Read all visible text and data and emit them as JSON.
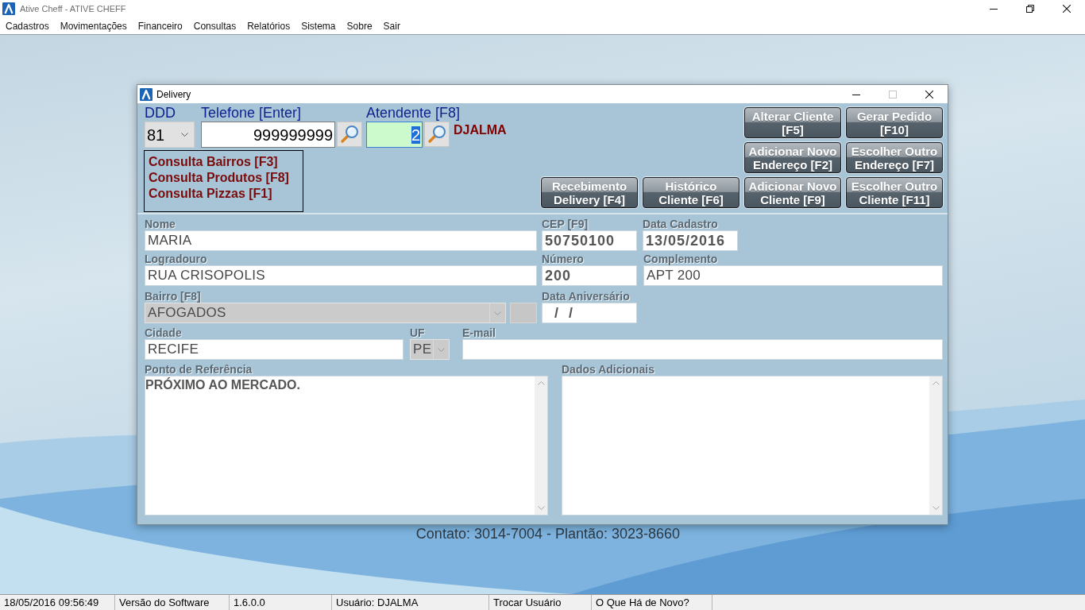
{
  "window": {
    "title": "Ative Cheff - ATIVE CHEFF",
    "controls": [
      {
        "kind": "minimize",
        "disabled": false
      },
      {
        "kind": "restore",
        "disabled": false
      },
      {
        "kind": "close",
        "disabled": false
      }
    ]
  },
  "menu": [
    "Cadastros",
    "Movimentações",
    "Financeiro",
    "Consultas",
    "Relatórios",
    "Sistema",
    "Sobre",
    "Sair"
  ],
  "desktop": {
    "contact": "Contato: 3014-7004 - Plantão: 3023-8660"
  },
  "dialog": {
    "title": "Delivery",
    "controls": [
      {
        "kind": "minimize",
        "disabled": false
      },
      {
        "kind": "maximize",
        "disabled": true
      },
      {
        "kind": "close",
        "disabled": false
      }
    ],
    "lookup": [
      {
        "kind": "select",
        "label": "DDD",
        "value": "81",
        "focused": false
      },
      {
        "kind": "search",
        "label": "Telefone [Enter]",
        "value": "999999999",
        "focused": false
      },
      {
        "kind": "search",
        "label": "Atendente [F8]",
        "value": "2",
        "focused": true,
        "result": "DJALMA"
      }
    ],
    "shortcuts": [
      "Consulta Bairros [F3]",
      "Consulta Produtos [F8]",
      "Consulta Pizzas [F1]"
    ],
    "button_rows": [
      [
        {
          "lines": [
            "Alterar Cliente",
            "[F5]"
          ]
        },
        {
          "lines": [
            "Gerar Pedido",
            "[F10]"
          ]
        }
      ],
      [
        {
          "lines": [
            "Adicionar Novo",
            "Endereço [F2]"
          ]
        },
        {
          "lines": [
            "Escolher Outro",
            "Endereço [F7]"
          ]
        }
      ],
      [
        {
          "lines": [
            "Recebimento",
            "Delivery [F4]"
          ]
        },
        {
          "lines": [
            "Histórico",
            "Cliente [F6]"
          ]
        },
        {
          "lines": [
            "Adicionar Novo",
            "Cliente [F9]"
          ]
        },
        {
          "lines": [
            "Escolher Outro",
            "Cliente [F11]"
          ]
        }
      ]
    ],
    "field_rows": [
      [
        {
          "kind": "text",
          "label": "Nome",
          "value": "MARIA",
          "disabled": false
        },
        {
          "kind": "number",
          "label": "CEP [F9]",
          "value": "50750100",
          "disabled": false
        },
        {
          "kind": "date",
          "label": "Data Cadastro",
          "value": "13/05/2016",
          "disabled": false
        }
      ],
      [
        {
          "kind": "text",
          "label": "Logradouro",
          "value": "RUA CRISOPOLIS",
          "disabled": false
        },
        {
          "kind": "number",
          "label": "Número",
          "value": "200",
          "disabled": false
        },
        {
          "kind": "text",
          "label": "Complemento",
          "value": "APT 200",
          "disabled": false
        }
      ],
      [
        {
          "kind": "select",
          "label": "Bairro [F8]",
          "value": "AFOGADOS",
          "disabled": true
        },
        {
          "kind": "button",
          "disabled": true
        },
        {
          "kind": "date",
          "label": "Data Aniversário",
          "value": "  /  /",
          "disabled": false
        }
      ],
      [
        {
          "kind": "text",
          "label": "Cidade",
          "value": "RECIFE",
          "disabled": false
        },
        {
          "kind": "select",
          "label": "UF",
          "value": "PE",
          "disabled": true
        },
        {
          "kind": "text",
          "label": "E-mail",
          "disabled": false
        }
      ]
    ],
    "notes": [
      {
        "label": "Ponto de Referência",
        "value": "PRÓXIMO AO MERCADO."
      },
      {
        "label": "Dados Adicionais"
      }
    ]
  },
  "status_bar": [
    "18/05/2016 09:56:49",
    "Versão do Software",
    "1.6.0.0",
    "Usuário: DJALMA",
    "Trocar Usuário",
    "O Que Há de Novo?"
  ]
}
